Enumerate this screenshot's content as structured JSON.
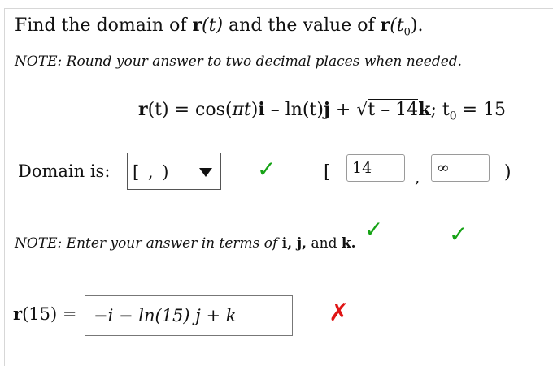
{
  "question": {
    "title_prefix": "Find the domain of ",
    "title_r_t": "r",
    "title_t_paren": "(t)",
    "title_middle": " and the value of ",
    "title_r_t0": "r",
    "title_t0_paren": "(t",
    "title_sub0": "0",
    "title_end": ").",
    "note_round": "NOTE: Round your answer to two decimal places when needed."
  },
  "equation": {
    "lhs_r": "r",
    "lhs_t": "(t) = cos(",
    "pi_t": "πt",
    "i_term_close": ")",
    "i_vec": "i",
    "ln_part": " – ln(t)",
    "j_vec": "j",
    "plus": " + ",
    "sqrt_symbol": "√",
    "sqrt_body": "t – 14",
    "k_vec": "k",
    "t0_label": "; t",
    "t0_sub": "0",
    "t0_value": " = 15"
  },
  "domain": {
    "label": "Domain is:",
    "interval_type_display": "[ ,  )",
    "left_bracket": "[",
    "lower_value": "14",
    "sep": ",",
    "upper_value": "∞",
    "right_bracket": ")"
  },
  "note_terms": {
    "prefix": "NOTE: Enter your answer in terms of ",
    "vecs": "i, j,",
    "and_text": " and ",
    "k": "k."
  },
  "value_answer": {
    "label_r": "r",
    "label_rest": "(15) =",
    "entered": "−i − ln(15) j + k"
  },
  "marks": {
    "check_symbol": "✓",
    "cross_symbol": "✗"
  },
  "colors": {
    "correct": "#16a316",
    "incorrect": "#e01515"
  }
}
